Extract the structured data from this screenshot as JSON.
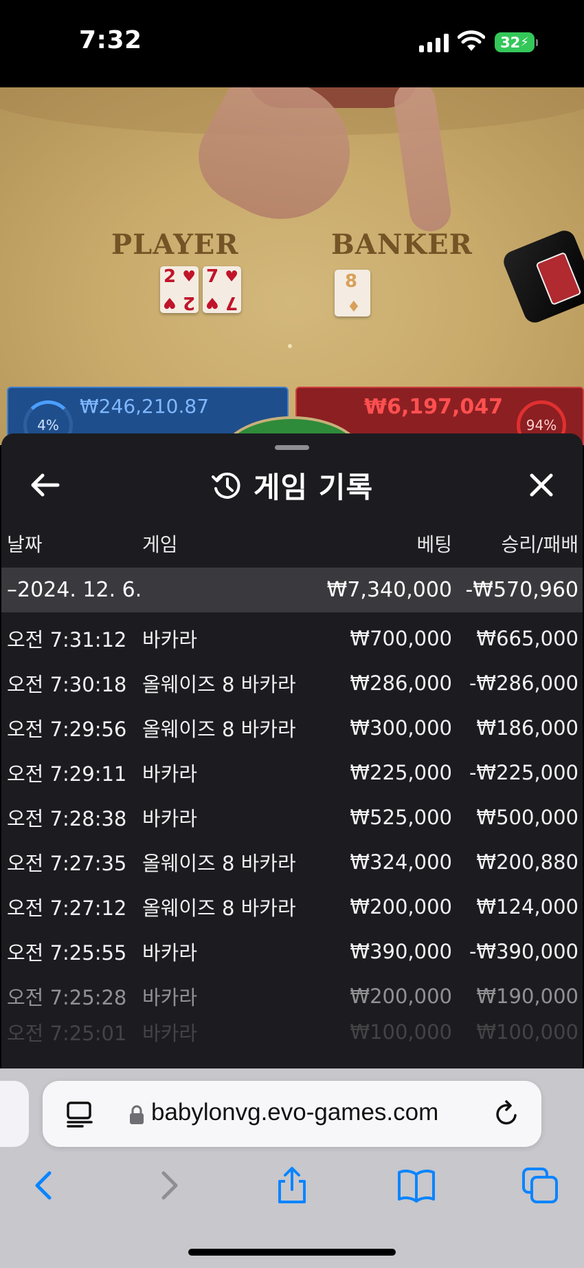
{
  "status_bar": {
    "time": "7:32",
    "battery": "32"
  },
  "game_video": {
    "player_label": "PLAYER",
    "banker_label": "BANKER",
    "player_cards": [
      {
        "rank": "2",
        "suit": "♥"
      },
      {
        "rank": "7",
        "suit": "♥"
      }
    ],
    "banker_cards": [
      {
        "rank": "8",
        "suit": "♦"
      }
    ],
    "player_bet_total": "₩246,210.87",
    "player_pct": "4%",
    "banker_bet_total": "₩6,197,047",
    "banker_pct": "94%"
  },
  "panel": {
    "title": "게임 기록",
    "columns": {
      "date": "날짜",
      "game": "게임",
      "bet": "베팅",
      "result": "승리/패배"
    },
    "group": {
      "date": "–2024. 12. 6.",
      "bet": "₩7,340,000",
      "result": "-₩570,960"
    },
    "rows": [
      {
        "time": "오전 7:31:12",
        "game": "바카라",
        "bet": "₩700,000",
        "result": "₩665,000"
      },
      {
        "time": "오전 7:30:18",
        "game": "올웨이즈 8 바카라",
        "bet": "₩286,000",
        "result": "-₩286,000"
      },
      {
        "time": "오전 7:29:56",
        "game": "올웨이즈 8 바카라",
        "bet": "₩300,000",
        "result": "₩186,000"
      },
      {
        "time": "오전 7:29:11",
        "game": "바카라",
        "bet": "₩225,000",
        "result": "-₩225,000"
      },
      {
        "time": "오전 7:28:38",
        "game": "바카라",
        "bet": "₩525,000",
        "result": "₩500,000"
      },
      {
        "time": "오전 7:27:35",
        "game": "올웨이즈 8 바카라",
        "bet": "₩324,000",
        "result": "₩200,880"
      },
      {
        "time": "오전 7:27:12",
        "game": "올웨이즈 8 바카라",
        "bet": "₩200,000",
        "result": "₩124,000"
      },
      {
        "time": "오전 7:25:55",
        "game": "바카라",
        "bet": "₩390,000",
        "result": "-₩390,000"
      },
      {
        "time": "오전 7:25:28",
        "game": "바카라",
        "bet": "₩200,000",
        "result": "₩190,000"
      },
      {
        "time": "오전 7:25:01",
        "game": "바카라",
        "bet": "₩100,000",
        "result": "₩100,000"
      }
    ]
  },
  "browser": {
    "url": "babylonvg.evo-games.com"
  },
  "colors": {
    "panel_bg": "#1c1c20",
    "group_row_bg": "#3a3a3e",
    "browser_accent": "#0a84ff",
    "battery_green": "#34c759"
  }
}
